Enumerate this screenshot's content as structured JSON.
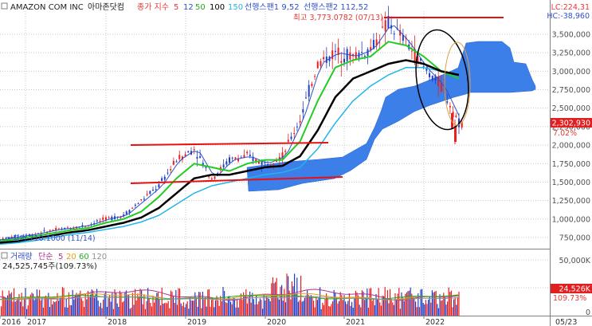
{
  "header": {
    "stock_name": "AMAZON COM INC",
    "stock_name_kr": "아마존닷컴",
    "ma_label": "종가 지수",
    "ma_periods": [
      "5",
      "12",
      "50",
      "100",
      "150"
    ],
    "ichimoku1": "선행스팬1 9,52",
    "ichimoku2": "선행스팬2 112,52"
  },
  "price_panel": {
    "high_note": "최고 3,773.0782 (07/13)",
    "low_note": "최저 710.1000 (11/14)",
    "lc": "LC:224,31",
    "hc": "HC:-38,960",
    "current_price": "2,302,930",
    "change_pct": "7.02%",
    "y_ticks": [
      "3,500,000",
      "3,250,000",
      "3,000,000",
      "2,750,000",
      "2,500,000",
      "2,250,000",
      "2,000,000",
      "1,750,000",
      "1,500,000",
      "1,250,000",
      "1,000,000",
      "750,000"
    ]
  },
  "volume_panel": {
    "legend_label": "거래량",
    "legend_ma": "단순",
    "legend_periods": [
      "5",
      "20",
      "60",
      "120"
    ],
    "volume_text": "24,525,745주(109.73%)",
    "y_ticks": [
      "50,000K",
      "0"
    ],
    "current_volume": "24,526K",
    "current_pct": "109.73%"
  },
  "x_axis": {
    "labels": [
      "2016",
      "2017",
      "2018",
      "2019",
      "2020",
      "2021",
      "2022",
      "05/23"
    ]
  },
  "colors": {
    "up": "#e8201e",
    "down": "#1f3fc8",
    "ma5": "#e53935",
    "ma12": "#3050c8",
    "ma50": "#22cc22",
    "ma100": "#000000",
    "ma150": "#22b5e8",
    "cloud": "#3d7fe8",
    "trendline": "#e81010",
    "ellipse": "#000000",
    "price_box": "#e02020",
    "ma_tags": [
      "#e53935",
      "#3050c8",
      "#22aa22",
      "#000000",
      "#22b5e8"
    ]
  },
  "chart_data": {
    "type": "line",
    "title": "AMAZON COM INC 아마존닷컴",
    "ylim": [
      600000,
      3900000
    ],
    "x": [
      "2016-01",
      "2016-04",
      "2016-07",
      "2016-10",
      "2017-01",
      "2017-04",
      "2017-07",
      "2017-10",
      "2018-01",
      "2018-04",
      "2018-07",
      "2018-10",
      "2019-01",
      "2019-04",
      "2019-07",
      "2019-10",
      "2020-01",
      "2020-04",
      "2020-07",
      "2020-10",
      "2021-01",
      "2021-04",
      "2021-07",
      "2021-10",
      "2022-01",
      "2022-04",
      "2022-05"
    ],
    "series": [
      {
        "name": "종가",
        "values": [
          720000,
          760000,
          800000,
          850000,
          880000,
          920000,
          1000000,
          1050000,
          1250000,
          1450000,
          1800000,
          1950000,
          1550000,
          1800000,
          1850000,
          1750000,
          1850000,
          2350000,
          3100000,
          3250000,
          3200000,
          3300000,
          3650000,
          3400000,
          3050000,
          2800000,
          2300000
        ]
      },
      {
        "name": "50",
        "values": [
          700000,
          730000,
          770000,
          810000,
          850000,
          880000,
          950000,
          1000000,
          1100000,
          1300000,
          1550000,
          1750000,
          1700000,
          1650000,
          1750000,
          1800000,
          1800000,
          2050000,
          2600000,
          3050000,
          3150000,
          3200000,
          3400000,
          3350000,
          3200000,
          3000000,
          2900000
        ]
      },
      {
        "name": "100",
        "values": [
          680000,
          700000,
          740000,
          780000,
          820000,
          850000,
          900000,
          950000,
          1020000,
          1150000,
          1350000,
          1550000,
          1600000,
          1600000,
          1650000,
          1700000,
          1720000,
          1850000,
          2200000,
          2650000,
          2900000,
          3000000,
          3100000,
          3150000,
          3100000,
          3000000,
          2950000
        ]
      },
      {
        "name": "150",
        "values": [
          660000,
          680000,
          710000,
          750000,
          790000,
          820000,
          860000,
          900000,
          960000,
          1050000,
          1200000,
          1350000,
          1450000,
          1500000,
          1550000,
          1600000,
          1630000,
          1700000,
          1950000,
          2300000,
          2600000,
          2800000,
          2950000,
          3050000,
          3050000,
          3000000,
          2900000
        ]
      }
    ]
  }
}
